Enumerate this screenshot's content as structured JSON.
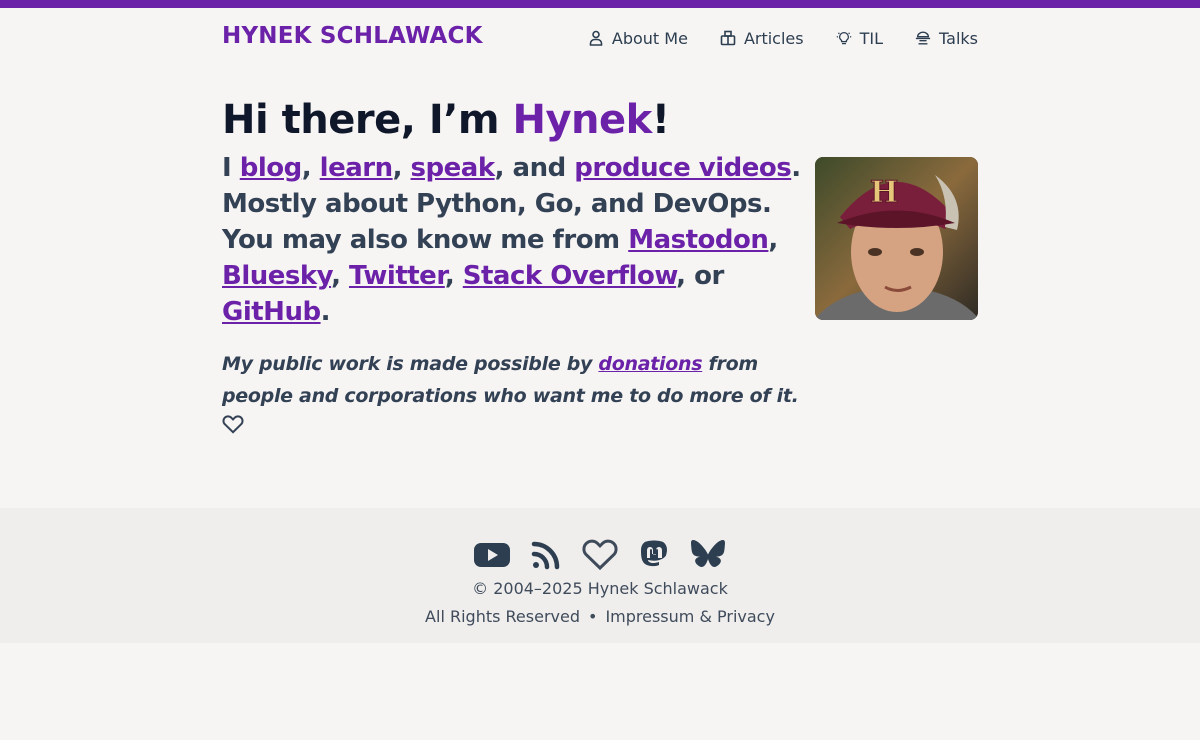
{
  "header": {
    "logo": "HYNEK SCHLAWACK",
    "nav": [
      {
        "label": "About Me",
        "icon": "person-icon"
      },
      {
        "label": "Articles",
        "icon": "articles-icon"
      },
      {
        "label": "TIL",
        "icon": "lightbulb-icon"
      },
      {
        "label": "Talks",
        "icon": "lectern-icon"
      }
    ]
  },
  "hero": {
    "greeting_pre": "Hi there, I’m ",
    "greeting_name": "Hynek",
    "greeting_post": "!",
    "lead": {
      "t0": "I ",
      "blog": "blog",
      "t1": ", ",
      "learn": "learn",
      "t2": ", ",
      "speak": "speak",
      "t3": ", and ",
      "videos": "produce videos",
      "t4": ". Mostly about Python, Go, and DevOps. You may also know me from ",
      "mastodon": "Mastodon",
      "t5": ", ",
      "bluesky": "Bluesky",
      "t6": ", ",
      "twitter": "Twitter",
      "t7": ", ",
      "stackoverflow": "Stack Overflow",
      "t8": ", or ",
      "github": "GitHub",
      "t9": "."
    },
    "note": {
      "pre": "My public work is made possible by ",
      "donations": "donations",
      "post": " from people and corporations who want me to do more of it."
    }
  },
  "footer": {
    "icons": [
      "youtube-icon",
      "rss-icon",
      "heart-icon",
      "mastodon-icon",
      "bluesky-icon"
    ],
    "copyright": "© 2004–2025 Hynek Schlawack",
    "rights": "All Rights Reserved",
    "separator": "•",
    "impressum": "Impressum & Privacy"
  },
  "colors": {
    "accent": "#6b21a8",
    "text": "#2c3e50",
    "background": "#f7f5f4",
    "footer_bg": "#efeeed"
  }
}
